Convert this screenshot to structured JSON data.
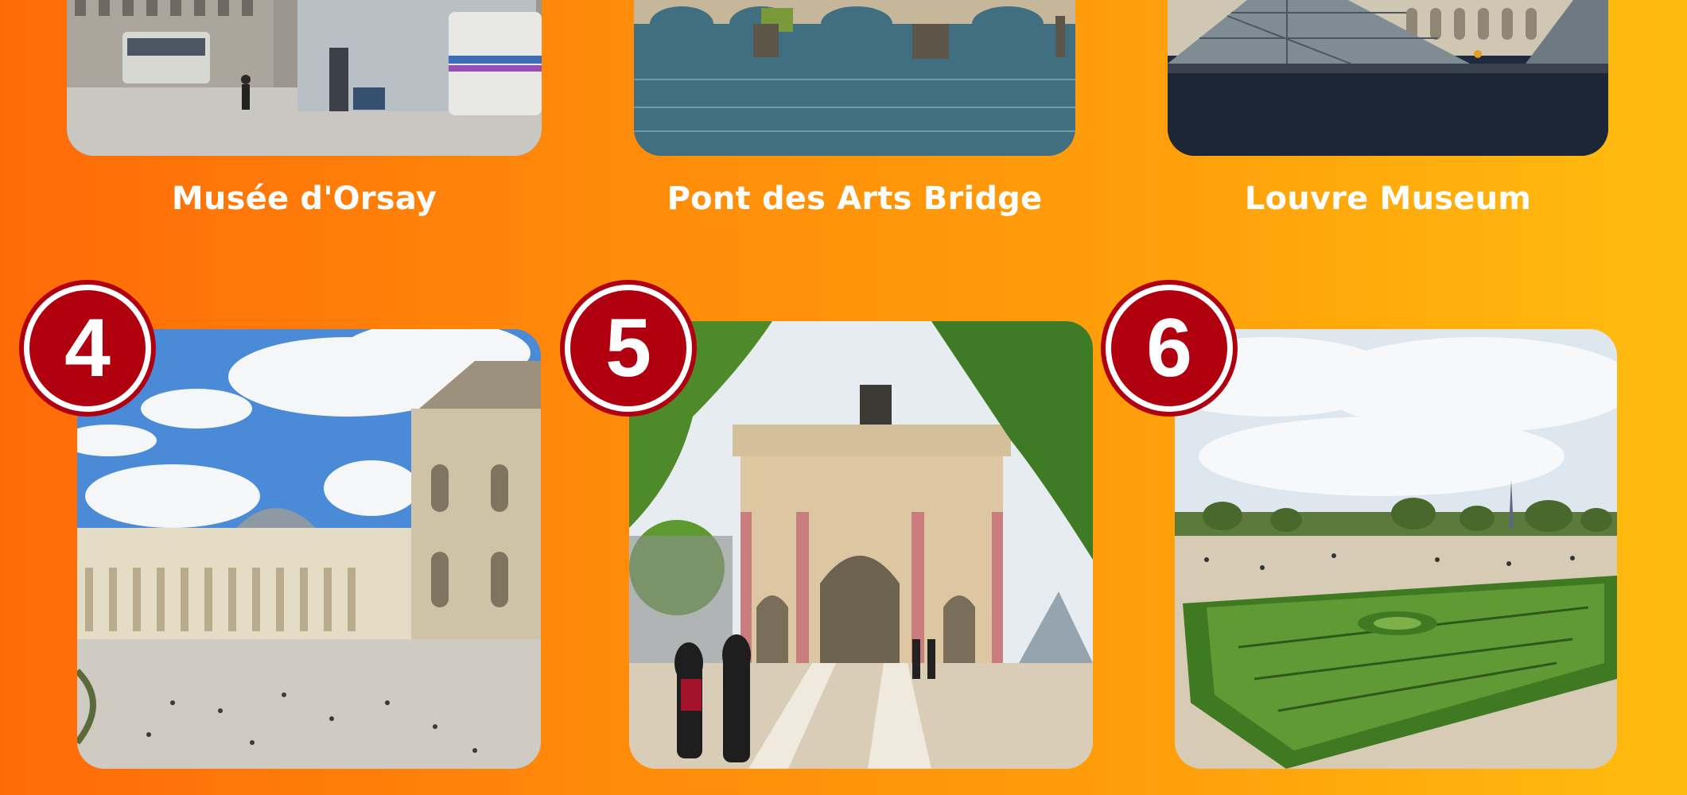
{
  "top_row": [
    {
      "caption": "Musée d'Orsay",
      "photo": "orsay-street-photo"
    },
    {
      "caption": "Pont des Arts Bridge",
      "photo": "seine-bridge-photo"
    },
    {
      "caption": "Louvre Museum",
      "photo": "louvre-pyramid-photo"
    }
  ],
  "bottom_row": [
    {
      "number": "4",
      "photo": "louvre-courtyard-photo"
    },
    {
      "number": "5",
      "photo": "arc-du-carrousel-photo"
    },
    {
      "number": "6",
      "photo": "tuileries-garden-photo"
    }
  ],
  "colors": {
    "background_left": "#ff6a08",
    "background_right": "#ffbc0e",
    "badge": "#b0000f",
    "caption_text": "#ffffff"
  }
}
